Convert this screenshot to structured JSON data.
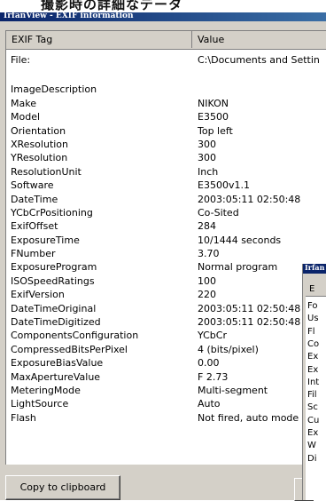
{
  "caption_text": "撮影時の詳細なデータ",
  "window": {
    "title": "IrfanView - EXIF information",
    "columns": {
      "tag": "EXIF Tag",
      "value": "Value"
    },
    "rows": [
      {
        "tag": "File:",
        "value": "C:\\Documents and Settin"
      },
      {
        "tag": "",
        "value": ""
      },
      {
        "tag": "ImageDescription",
        "value": ""
      },
      {
        "tag": "Make",
        "value": "NIKON"
      },
      {
        "tag": "Model",
        "value": "E3500"
      },
      {
        "tag": "Orientation",
        "value": "Top left"
      },
      {
        "tag": "XResolution",
        "value": "300"
      },
      {
        "tag": "YResolution",
        "value": "300"
      },
      {
        "tag": "ResolutionUnit",
        "value": "Inch"
      },
      {
        "tag": "Software",
        "value": "E3500v1.1"
      },
      {
        "tag": "DateTime",
        "value": "2003:05:11 02:50:48"
      },
      {
        "tag": "YCbCrPositioning",
        "value": "Co-Sited"
      },
      {
        "tag": "ExifOffset",
        "value": "284"
      },
      {
        "tag": "ExposureTime",
        "value": "10/1444 seconds"
      },
      {
        "tag": "FNumber",
        "value": "3.70"
      },
      {
        "tag": "ExposureProgram",
        "value": "Normal program"
      },
      {
        "tag": "ISOSpeedRatings",
        "value": "100"
      },
      {
        "tag": "ExifVersion",
        "value": "220"
      },
      {
        "tag": "DateTimeOriginal",
        "value": "2003:05:11 02:50:48"
      },
      {
        "tag": "DateTimeDigitized",
        "value": "2003:05:11 02:50:48"
      },
      {
        "tag": "ComponentsConfiguration",
        "value": "YCbCr"
      },
      {
        "tag": "CompressedBitsPerPixel",
        "value": "4 (bits/pixel)"
      },
      {
        "tag": "ExposureBiasValue",
        "value": "0.00"
      },
      {
        "tag": "MaxApertureValue",
        "value": "F 2.73"
      },
      {
        "tag": "MeteringMode",
        "value": "Multi-segment"
      },
      {
        "tag": "LightSource",
        "value": "Auto"
      },
      {
        "tag": "Flash",
        "value": "Not fired, auto mode"
      }
    ],
    "copy_button": "Copy to clipboard"
  },
  "second_window": {
    "title": "Irfan",
    "header": "E",
    "rows": [
      "Fo",
      "Us",
      "Fl",
      "Co",
      "Ex",
      "Ex",
      "Int",
      "Fil",
      "Sc",
      "Cu",
      "Ex",
      "W",
      "Di"
    ]
  }
}
